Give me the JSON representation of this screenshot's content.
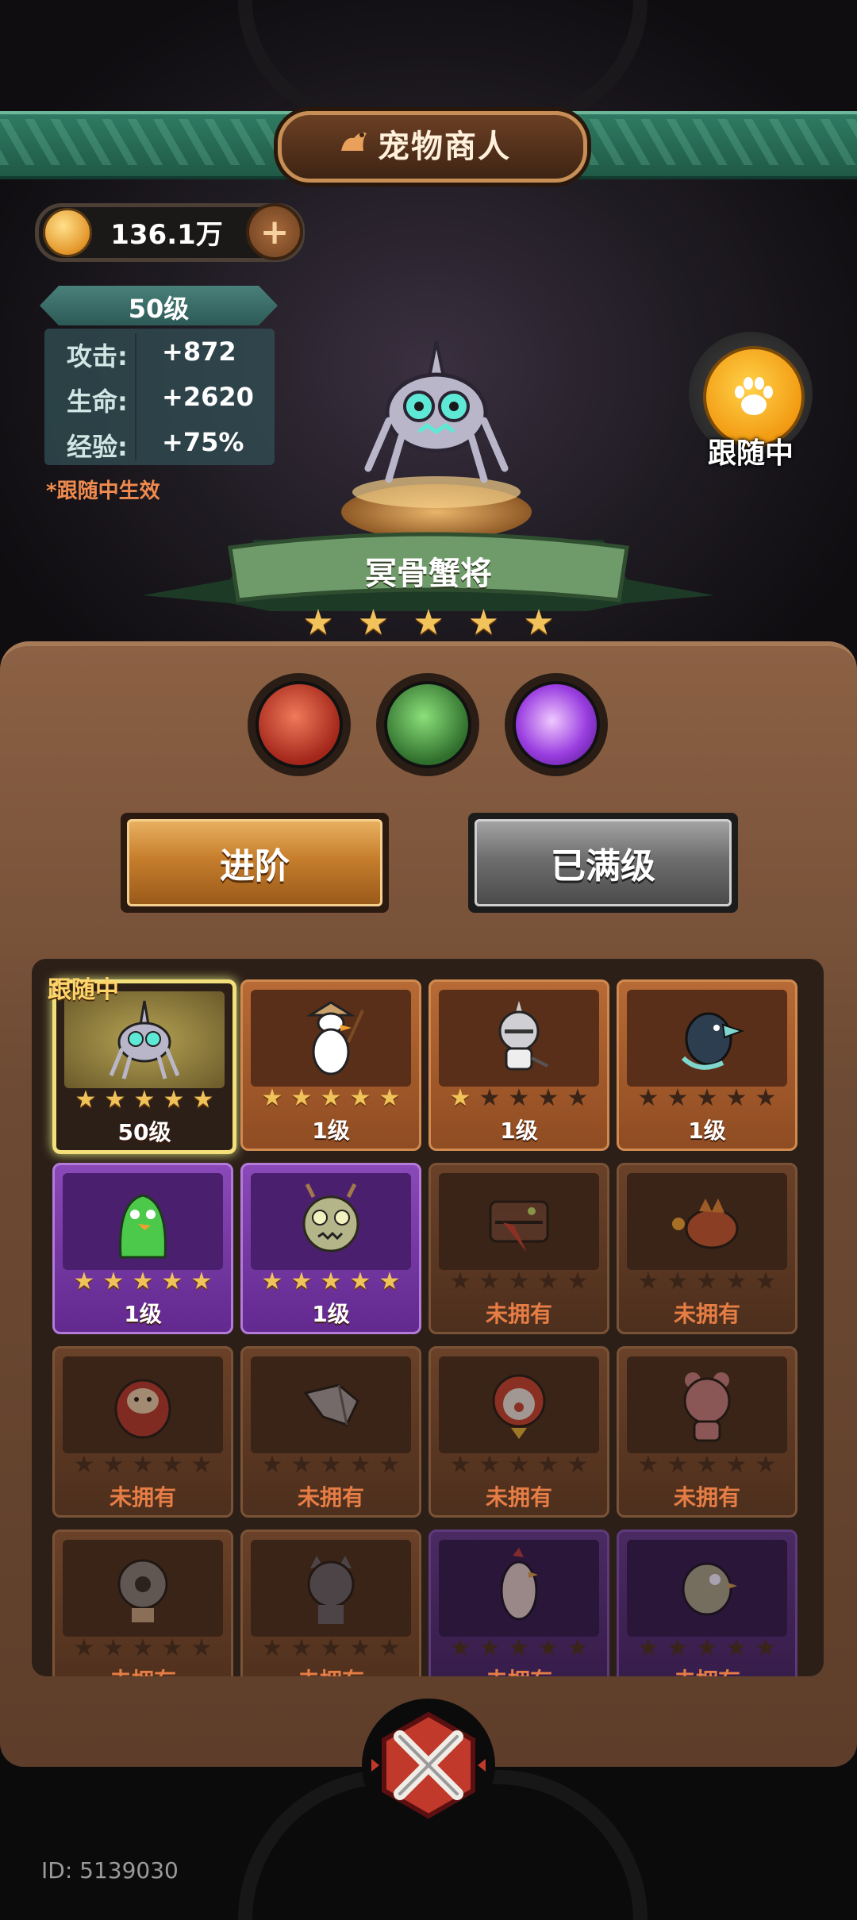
{
  "header": {
    "title": "宠物商人"
  },
  "currency": {
    "value": "136.1万"
  },
  "stats": {
    "level": "50级",
    "rows": [
      {
        "label": "攻击:",
        "value": "+872"
      },
      {
        "label": "生命:",
        "value": "+2620"
      },
      {
        "label": "经验:",
        "value": "+75%"
      }
    ],
    "note": "*跟随中生效"
  },
  "follow": {
    "label": "跟随中"
  },
  "pet": {
    "name": "冥骨蟹将",
    "stars": 5
  },
  "skills": [
    {
      "icon": "fire-fist-icon",
      "color": "#c0392b"
    },
    {
      "icon": "green-claw-icon",
      "color": "#3d8f3a"
    },
    {
      "icon": "purple-chat-icon",
      "color": "#8e3bd6"
    }
  ],
  "buttons": {
    "advance": "进阶",
    "maxed": "已满级"
  },
  "grid": {
    "follow_tag": "跟随中",
    "cards": [
      {
        "pet": "crab-general",
        "stars": 5,
        "label": "50级",
        "variant": "sel"
      },
      {
        "pet": "straw-hat-duck",
        "stars": 5,
        "label": "1级",
        "variant": "orange"
      },
      {
        "pet": "helmet-knight",
        "stars": 1,
        "label": "1级",
        "variant": "orange"
      },
      {
        "pet": "crow-knight",
        "stars": 0,
        "label": "1级",
        "variant": "orange"
      },
      {
        "pet": "green-blob",
        "stars": 5,
        "label": "1级",
        "variant": "purple"
      },
      {
        "pet": "antler-skull",
        "stars": 5,
        "label": "1级",
        "variant": "purple"
      },
      {
        "pet": "mimic-chest",
        "stars": 0,
        "label": "未拥有",
        "variant": "dim"
      },
      {
        "pet": "fire-dragon",
        "stars": 0,
        "label": "未拥有",
        "variant": "dim"
      },
      {
        "pet": "daruma",
        "stars": 0,
        "label": "未拥有",
        "variant": "dim"
      },
      {
        "pet": "gauntlet",
        "stars": 0,
        "label": "未拥有",
        "variant": "dim"
      },
      {
        "pet": "clown-bird",
        "stars": 0,
        "label": "未拥有",
        "variant": "dim"
      },
      {
        "pet": "pink-bear",
        "stars": 0,
        "label": "未拥有",
        "variant": "dim"
      },
      {
        "pet": "round-robot",
        "stars": 0,
        "label": "未拥有",
        "variant": "dim"
      },
      {
        "pet": "grey-cat",
        "stars": 0,
        "label": "未拥有",
        "variant": "dim"
      },
      {
        "pet": "rooster",
        "stars": 0,
        "label": "未拥有",
        "variant": "dimp"
      },
      {
        "pet": "zombie-bird",
        "stars": 0,
        "label": "未拥有",
        "variant": "dimp"
      }
    ]
  },
  "footer": {
    "uid": "ID: 5139030"
  }
}
